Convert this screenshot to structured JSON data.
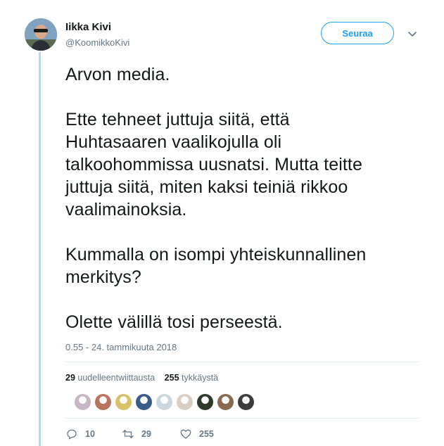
{
  "author": {
    "name": "Iikka Kivi",
    "handle": "@KoomikkoKivi"
  },
  "follow_label": "Seuraa",
  "tweet": {
    "paragraphs": [
      "Arvon media.",
      "Ette tehneet juttuja siitä, että\nHuhtasaaren vaalikojulla oli\ntalkoohommissa uusnatsi. Mutta teitte\njuttuja siitä, miten kaksi teiniä rikkoo\nvaalimainoksia.",
      "Kummalla on isompi yhteiskunnallinen\nmerkitys?",
      "Olette välillä tosi perseestä."
    ],
    "timestamp": "0.55 - 24. tammikuuta 2018"
  },
  "stats": {
    "retweets_count": "29",
    "retweets_label": "uudelleentwiittausta",
    "likes_count": "255",
    "likes_label": "tykkäystä"
  },
  "liker_avatar_colors": [
    "#c9b6c4",
    "#b8745f",
    "#d9c16a",
    "#3a5c8a",
    "#ccd6dd",
    "#d8cfc2",
    "#2f3a2c",
    "#8a6a4f",
    "#3c3c3c"
  ],
  "actions": {
    "reply_count": "10",
    "retweet_count": "29",
    "like_count": "255"
  },
  "colors": {
    "accent": "#1da1f2",
    "thread_line": "#a9dcf7",
    "secondary_text": "#657786"
  }
}
